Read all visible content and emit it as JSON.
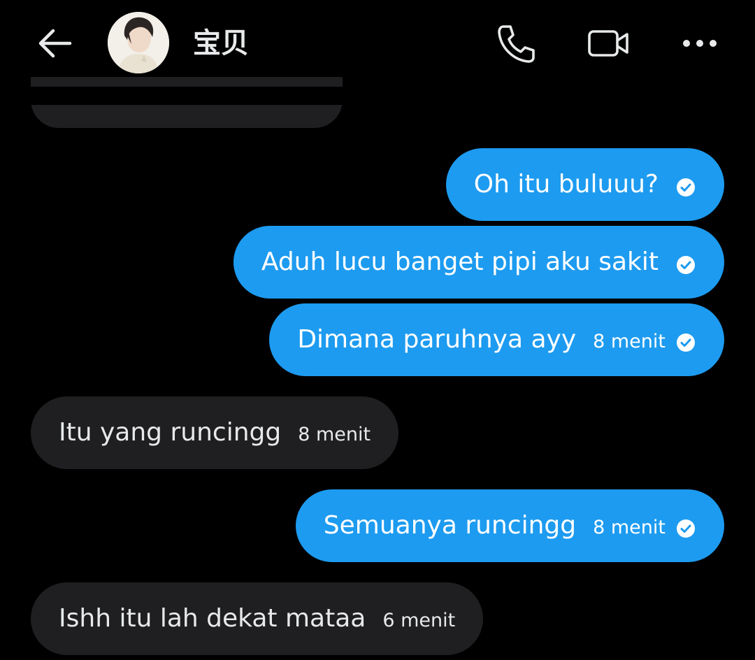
{
  "header": {
    "contact_name": "宝贝",
    "icons": {
      "back": "arrow-left-icon",
      "call": "phone-icon",
      "video": "video-camera-icon",
      "more": "more-horizontal-icon"
    }
  },
  "colors": {
    "outgoing_bubble": "#1d9bf0",
    "incoming_bubble": "#1f1f21",
    "background": "#000000"
  },
  "messages": [
    {
      "direction": "outgoing",
      "text": "Oh itu buluuu?",
      "time": "",
      "status": "read"
    },
    {
      "direction": "outgoing",
      "text": "Aduh lucu banget pipi aku sakit",
      "time": "",
      "status": "read"
    },
    {
      "direction": "outgoing",
      "text": "Dimana paruhnya ayy",
      "time": "8 menit",
      "status": "read"
    },
    {
      "direction": "incoming",
      "text": "Itu yang runcingg",
      "time": "8 menit"
    },
    {
      "direction": "outgoing",
      "text": "Semuanya runcingg",
      "time": "8 menit",
      "status": "read"
    },
    {
      "direction": "incoming",
      "text": "Ishh itu lah dekat mataa",
      "time": "6 menit"
    }
  ]
}
